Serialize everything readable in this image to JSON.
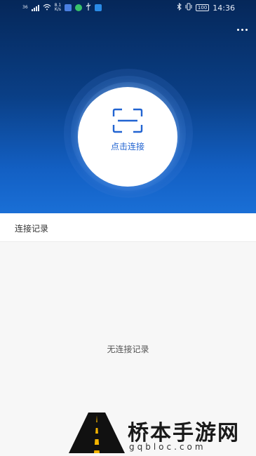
{
  "status_bar": {
    "signal_label": "36",
    "net_speed_top": "8.1",
    "net_speed_unit": "K/s",
    "battery": "100",
    "time": "14:36"
  },
  "colors": {
    "hero_top": "#052759",
    "hero_bottom": "#1a6fd6",
    "accent": "#2264d1"
  },
  "icons": {
    "menu": "more-vertical-dots",
    "scan": "scan-frame-icon"
  },
  "main": {
    "connect_label": "点击连接"
  },
  "records": {
    "title": "连接记录",
    "empty_text": "无连接记录"
  },
  "watermark": {
    "title": "桥本手游网",
    "url": "gqbloc.com"
  }
}
